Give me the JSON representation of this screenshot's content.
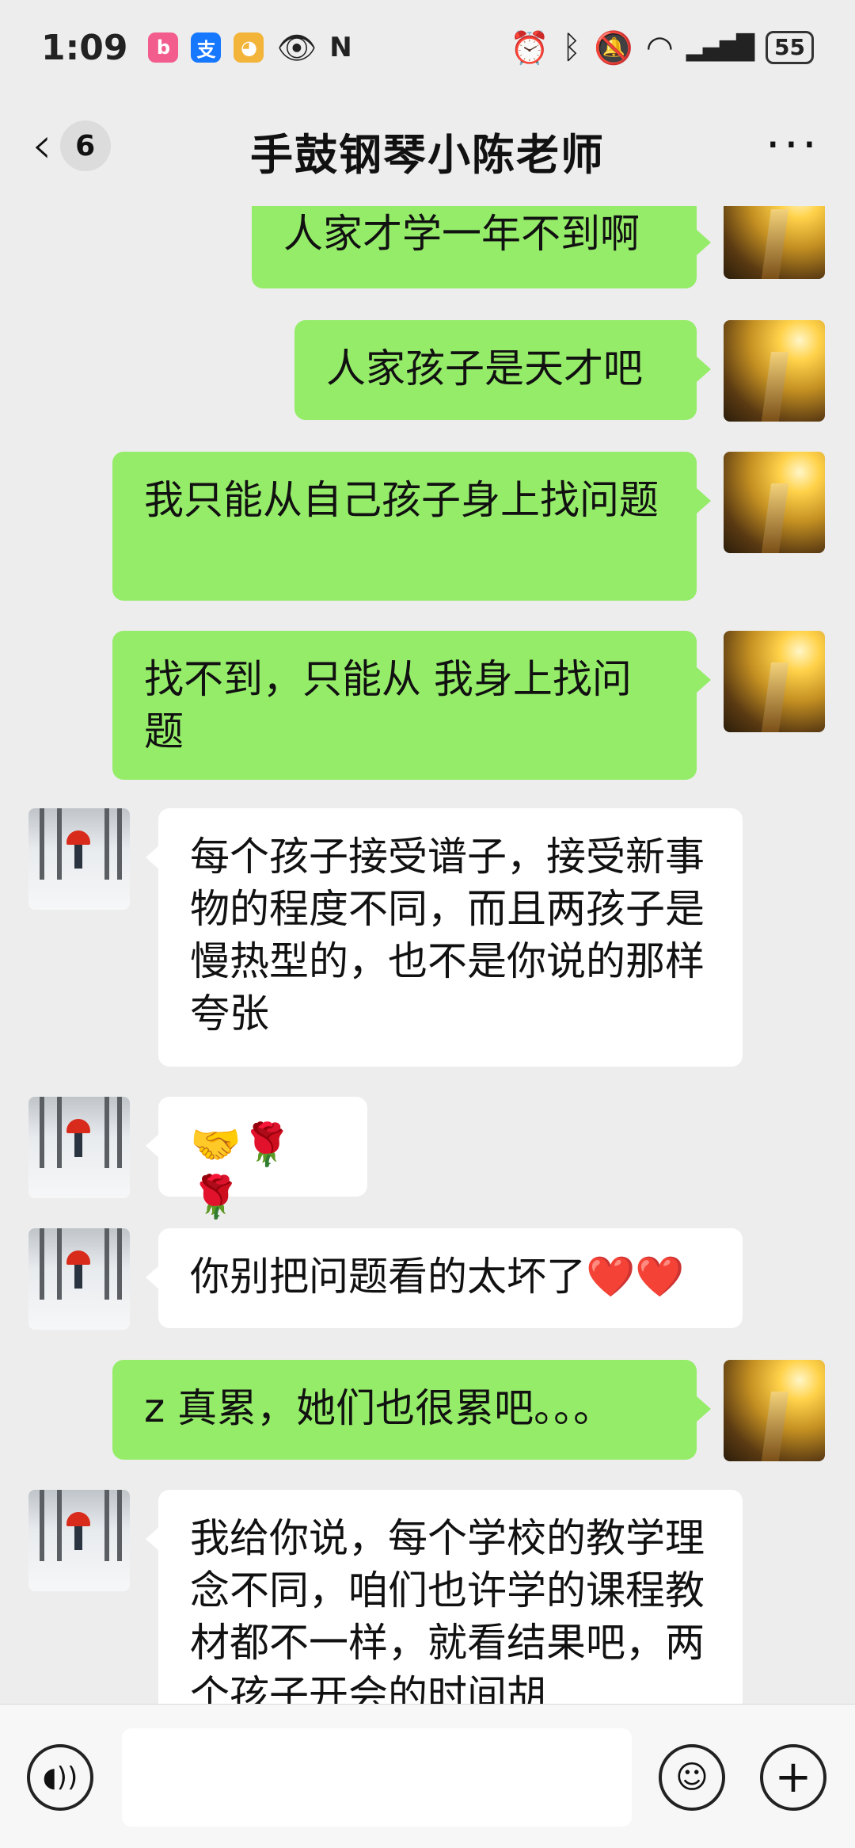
{
  "status_bar": {
    "time": "1:09",
    "battery": "55",
    "apps": [
      "bilibili-icon",
      "alipay-icon",
      "monkey-icon",
      "eye-icon",
      "nfc-icon"
    ],
    "indicators": [
      "alarm-icon",
      "bluetooth-icon",
      "mute-icon",
      "wifi-icon",
      "signal-icon"
    ]
  },
  "header": {
    "unread_count": "6",
    "title": "手鼓钢琴小陈老师",
    "more": "···"
  },
  "messages": [
    {
      "from": "me",
      "text": "人家才学一年不到啊"
    },
    {
      "from": "me",
      "text": "人家孩子是天才吧"
    },
    {
      "from": "me",
      "text": "我只能从自己孩子身上找问题"
    },
    {
      "from": "me",
      "text": "找不到，只能从 我身上找问题"
    },
    {
      "from": "them",
      "text": "每个孩子接受谱子，接受新事物的程度不同，而且两孩子是慢热型的，也不是你说的那样夸张"
    },
    {
      "from": "them",
      "text": "🤝🌹🌹"
    },
    {
      "from": "them",
      "text": "你别把问题看的太坏了❤️❤️"
    },
    {
      "from": "me",
      "text": "z 真累，她们也很累吧。。。"
    },
    {
      "from": "them",
      "text": "我给你说，每个学校的教学理念不同，咱们也许学的课程教材都不一样，就看结果吧，两个孩子开会的时间胡"
    }
  ],
  "input_bar": {
    "value": "",
    "placeholder": ""
  }
}
